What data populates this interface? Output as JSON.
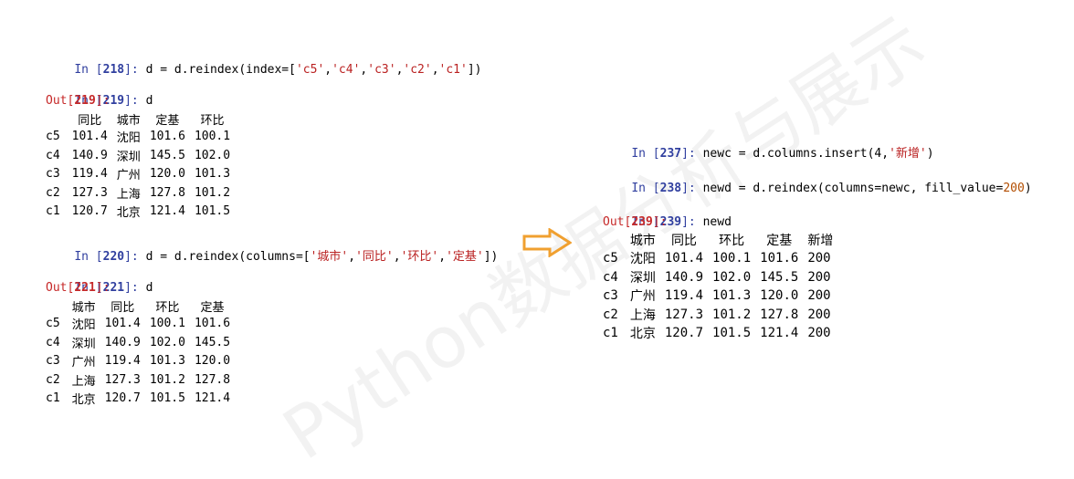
{
  "watermark": "Python数据分析与展示",
  "left": {
    "c218": {
      "prompt": "In [",
      "num": "218",
      "close": "]: ",
      "code_pre": "d = d.reindex(index=[",
      "s1": "'c5'",
      "s2": "'c4'",
      "s3": "'c3'",
      "s4": "'c2'",
      "s5": "'c1'",
      "code_post": "])"
    },
    "c219": {
      "prompt": "In [",
      "num": "219",
      "close": "]: ",
      "code": "d",
      "out_prompt": "Out[",
      "out_close": "]:"
    },
    "table1": {
      "headers": [
        "同比",
        "城市",
        "定基",
        "环比"
      ],
      "rows": [
        {
          "idx": "c5",
          "v1": "101.4",
          "v2": "沈阳",
          "v3": "101.6",
          "v4": "100.1"
        },
        {
          "idx": "c4",
          "v1": "140.9",
          "v2": "深圳",
          "v3": "145.5",
          "v4": "102.0"
        },
        {
          "idx": "c3",
          "v1": "119.4",
          "v2": "广州",
          "v3": "120.0",
          "v4": "101.3"
        },
        {
          "idx": "c2",
          "v1": "127.3",
          "v2": "上海",
          "v3": "127.8",
          "v4": "101.2"
        },
        {
          "idx": "c1",
          "v1": "120.7",
          "v2": "北京",
          "v3": "121.4",
          "v4": "101.5"
        }
      ]
    },
    "c220": {
      "prompt": "In [",
      "num": "220",
      "close": "]: ",
      "code_pre": "d = d.reindex(columns=[",
      "s1": "'城市'",
      "s2": "'同比'",
      "s3": "'环比'",
      "s4": "'定基'",
      "code_post": "])"
    },
    "c221": {
      "prompt": "In [",
      "num": "221",
      "close": "]: ",
      "code": "d",
      "out_prompt": "Out[",
      "out_close": "]:"
    },
    "table2": {
      "headers": [
        "城市",
        "同比",
        "环比",
        "定基"
      ],
      "rows": [
        {
          "idx": "c5",
          "v1": "沈阳",
          "v2": "101.4",
          "v3": "100.1",
          "v4": "101.6"
        },
        {
          "idx": "c4",
          "v1": "深圳",
          "v2": "140.9",
          "v3": "102.0",
          "v4": "145.5"
        },
        {
          "idx": "c3",
          "v1": "广州",
          "v2": "119.4",
          "v3": "101.3",
          "v4": "120.0"
        },
        {
          "idx": "c2",
          "v1": "上海",
          "v2": "127.3",
          "v3": "101.2",
          "v4": "127.8"
        },
        {
          "idx": "c1",
          "v1": "北京",
          "v2": "120.7",
          "v3": "101.5",
          "v4": "121.4"
        }
      ]
    }
  },
  "right": {
    "c237": {
      "prompt": "In [",
      "num": "237",
      "close": "]: ",
      "code_pre": "newc = d.columns.insert(4,",
      "s1": "'新增'",
      "code_post": ")"
    },
    "c238": {
      "prompt": "In [",
      "num": "238",
      "close": "]: ",
      "code_pre": "newd = d.reindex(columns=newc, fill_value=",
      "n1": "200",
      "code_post": ")"
    },
    "c239": {
      "prompt": "In [",
      "num": "239",
      "close": "]: ",
      "code": "newd",
      "out_prompt": "Out[",
      "out_close": "]:"
    },
    "table3": {
      "headers": [
        "城市",
        "同比",
        "环比",
        "定基",
        "新增"
      ],
      "rows": [
        {
          "idx": "c5",
          "v1": "沈阳",
          "v2": "101.4",
          "v3": "100.1",
          "v4": "101.6",
          "v5": "200"
        },
        {
          "idx": "c4",
          "v1": "深圳",
          "v2": "140.9",
          "v3": "102.0",
          "v4": "145.5",
          "v5": "200"
        },
        {
          "idx": "c3",
          "v1": "广州",
          "v2": "119.4",
          "v3": "101.3",
          "v4": "120.0",
          "v5": "200"
        },
        {
          "idx": "c2",
          "v1": "上海",
          "v2": "127.3",
          "v3": "101.2",
          "v4": "127.8",
          "v5": "200"
        },
        {
          "idx": "c1",
          "v1": "北京",
          "v2": "120.7",
          "v3": "101.5",
          "v4": "121.4",
          "v5": "200"
        }
      ]
    }
  },
  "colors": {
    "arrow": "#f0a030",
    "prompt": "#303f9f",
    "out": "#c62828",
    "string": "#ba2121"
  },
  "icons": {
    "arrow": "right-arrow-outline-icon"
  }
}
